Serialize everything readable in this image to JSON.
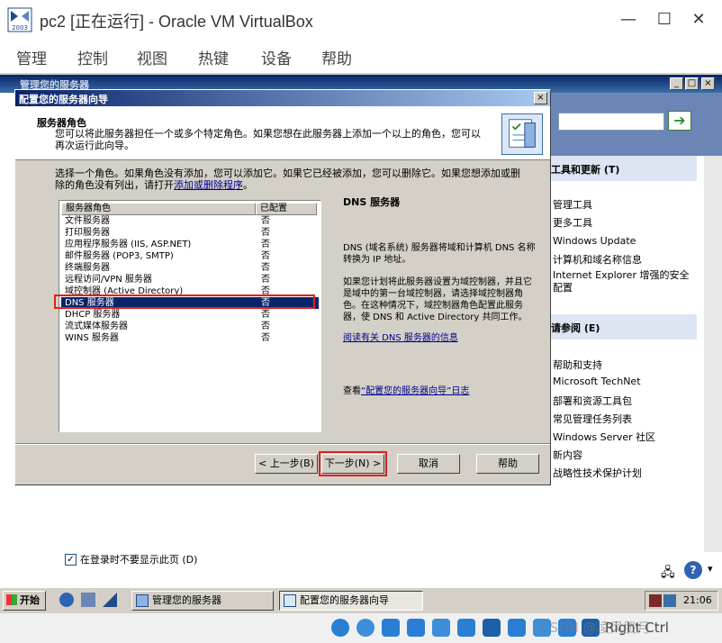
{
  "host": {
    "title": "pc2 [正在运行] - Oracle VM VirtualBox",
    "minimize": "—",
    "maximize": "☐",
    "close": "✕",
    "menu": [
      "管理",
      "控制",
      "视图",
      "热键",
      "设备",
      "帮助"
    ],
    "host_key": "Right Ctrl",
    "watermark": "CSDN @凌风胧月"
  },
  "bg_window": {
    "title": "管理您的服务器",
    "panels": [
      {
        "heading": "工具和更新 (T)",
        "links": [
          "管理工具",
          "更多工具",
          "Windows Update",
          "计算机和域名称信息",
          "Internet Explorer 增强的安全配置"
        ]
      },
      {
        "heading": "请参阅 (E)",
        "links": [
          "帮助和支持",
          "Microsoft TechNet",
          "部署和资源工具包",
          "常见管理任务列表",
          "Windows Server 社区",
          "新内容",
          "战略性技术保护计划"
        ]
      }
    ],
    "startup_checkbox": "在登录时不要显示此页 (D)"
  },
  "wizard": {
    "title": "配置您的服务器向导",
    "header_title": "服务器角色",
    "header_desc": "您可以将此服务器担任一个或多个特定角色。如果您想在此服务器上添加一个以上的角色，您可以再次运行此向导。",
    "intro": "选择一个角色。如果角色没有添加，您可以添加它。如果它已经被添加，您可以删除它。如果您想添加或删除的角色没有列出，请打开",
    "intro_link": "添加或删除程序",
    "intro_end": "。",
    "list_header_role": "服务器角色",
    "list_header_status": "已配置",
    "roles": [
      {
        "name": "文件服务器",
        "status": "否"
      },
      {
        "name": "打印服务器",
        "status": "否"
      },
      {
        "name": "应用程序服务器 (IIS, ASP.NET)",
        "status": "否"
      },
      {
        "name": "邮件服务器 (POP3, SMTP)",
        "status": "否"
      },
      {
        "name": "终端服务器",
        "status": "否"
      },
      {
        "name": "远程访问/VPN 服务器",
        "status": "否"
      },
      {
        "name": "域控制器 (Active Directory)",
        "status": "否"
      },
      {
        "name": "DNS 服务器",
        "status": "否"
      },
      {
        "name": "DHCP 服务器",
        "status": "否"
      },
      {
        "name": "流式媒体服务器",
        "status": "否"
      },
      {
        "name": "WINS 服务器",
        "status": "否"
      }
    ],
    "selected_role_index": 7,
    "desc_title": "DNS 服务器",
    "desc_p1": "DNS (域名系统) 服务器将域和计算机 DNS 名称转换为 IP 地址。",
    "desc_p2": "如果您计划将此服务器设置为域控制器，并且它是域中的第一台域控制器，请选择域控制器角色。在这种情况下，域控制器角色配置此服务器，使 DNS 和 Active Directory 共同工作。",
    "desc_link": "阅读有关 DNS 服务器的信息",
    "log_prefix": "查看",
    "log_link": "“配置您的服务器向导”日志",
    "buttons": {
      "back": "< 上一步(B)",
      "next": "下一步(N) >",
      "cancel": "取消",
      "help": "帮助"
    }
  },
  "taskbar": {
    "start": "开始",
    "tasks": [
      "管理您的服务器",
      "配置您的服务器向导"
    ],
    "clock": "21:06"
  },
  "colors": {
    "highlight": "#e02020",
    "selection": "#0a246a",
    "title_gradient": "#0a246a"
  }
}
